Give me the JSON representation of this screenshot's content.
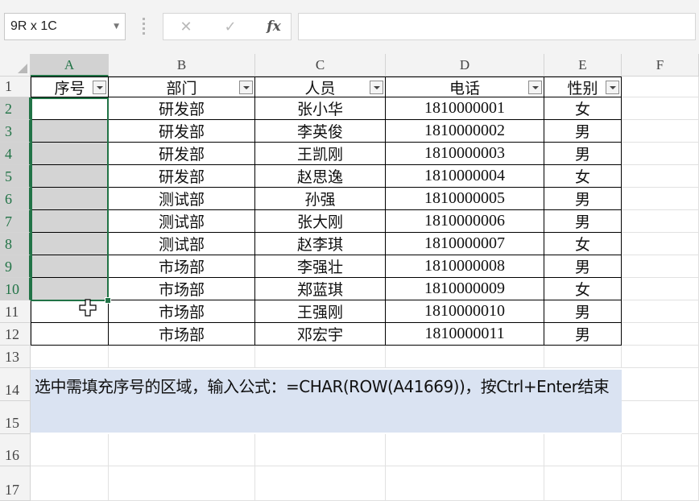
{
  "name_box": {
    "value": "9R x 1C"
  },
  "formula_bar": {
    "cancel_icon": "close-icon",
    "confirm_icon": "check-icon",
    "fx_label": "fx",
    "formula": ""
  },
  "columns": [
    "A",
    "B",
    "C",
    "D",
    "E",
    "F"
  ],
  "rows": [
    "1",
    "2",
    "3",
    "4",
    "5",
    "6",
    "7",
    "8",
    "9",
    "10",
    "11",
    "12",
    "13",
    "14",
    "15",
    "16",
    "17"
  ],
  "table": {
    "headers": [
      "序号",
      "部门",
      "人员",
      "电话",
      "性别"
    ],
    "records": [
      [
        "",
        "研发部",
        "张小华",
        "1810000001",
        "女"
      ],
      [
        "",
        "研发部",
        "李英俊",
        "1810000002",
        "男"
      ],
      [
        "",
        "研发部",
        "王凯刚",
        "1810000003",
        "男"
      ],
      [
        "",
        "研发部",
        "赵思逸",
        "1810000004",
        "女"
      ],
      [
        "",
        "测试部",
        "孙强",
        "1810000005",
        "男"
      ],
      [
        "",
        "测试部",
        "张大刚",
        "1810000006",
        "男"
      ],
      [
        "",
        "测试部",
        "赵李琪",
        "1810000007",
        "女"
      ],
      [
        "",
        "市场部",
        "李强壮",
        "1810000008",
        "男"
      ],
      [
        "",
        "市场部",
        "郑蓝琪",
        "1810000009",
        "女"
      ],
      [
        "",
        "市场部",
        "王强刚",
        "1810000010",
        "男"
      ],
      [
        "",
        "市场部",
        "邓宏宇",
        "1810000011",
        "男"
      ]
    ]
  },
  "note": {
    "text": "选中需填充序号的区域，输入公式：=CHAR(ROW(A41669))，按Ctrl+Enter结束"
  },
  "colors": {
    "selection": "#217346",
    "note_bg": "#dae3f2",
    "selected_fill": "#d4d4d4"
  }
}
